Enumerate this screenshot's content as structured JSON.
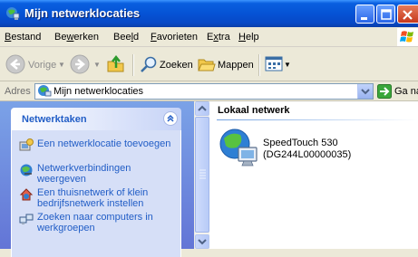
{
  "window": {
    "title": "Mijn netwerklocaties"
  },
  "menu": [
    {
      "label": "Bestand",
      "pre": "",
      "key": "B",
      "post": "estand"
    },
    {
      "label": "Bewerken",
      "pre": "Be",
      "key": "w",
      "post": "erken"
    },
    {
      "label": "Beeld",
      "pre": "Bee",
      "key": "l",
      "post": "d"
    },
    {
      "label": "Favorieten",
      "pre": "",
      "key": "F",
      "post": "avorieten"
    },
    {
      "label": "Extra",
      "pre": "E",
      "key": "x",
      "post": "tra"
    },
    {
      "label": "Help",
      "pre": "",
      "key": "H",
      "post": "elp"
    }
  ],
  "toolbar": {
    "back_label": "Vorige",
    "search_label": "Zoeken",
    "folders_label": "Mappen"
  },
  "address": {
    "label": "Adres",
    "value": "Mijn netwerklocaties",
    "go_label": "Ga naar"
  },
  "tasks": {
    "title": "Netwerktaken",
    "items": [
      {
        "label": "Een netwerklocatie toevoegen",
        "icon": "add-network-place-icon"
      },
      {
        "label": "Netwerkverbindingen weergeven",
        "icon": "network-connections-icon"
      },
      {
        "label": "Een thuisnetwerk of klein bedrijfsnetwerk instellen",
        "icon": "home-network-icon"
      },
      {
        "label": "Zoeken naar computers in werkgroepen",
        "icon": "workgroup-icon"
      }
    ]
  },
  "content": {
    "group_title": "Lokaal netwerk",
    "items": [
      {
        "name": "SpeedTouch 530",
        "id": "(DG244L00000035)",
        "icon": "network-device-icon"
      }
    ]
  },
  "colors": {
    "titlebar": "#0553d5",
    "task_link": "#215dc6",
    "panel_bg": "#7ba2e7"
  }
}
